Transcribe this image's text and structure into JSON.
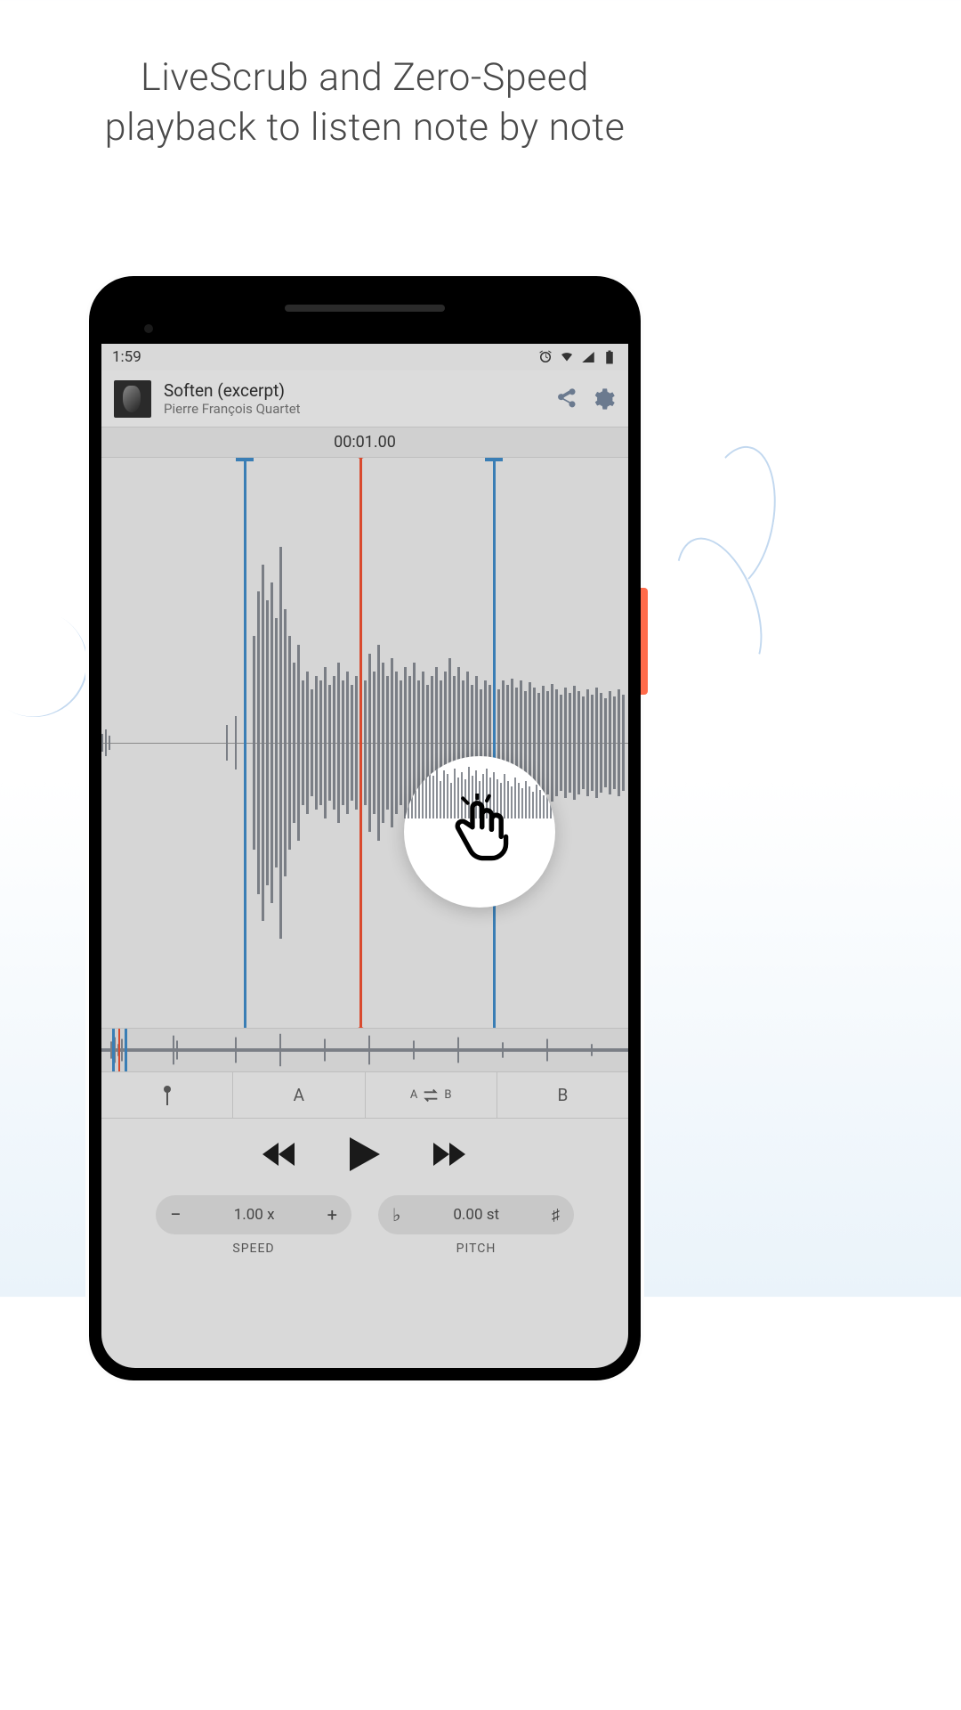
{
  "headline_line1": "LiveScrub and Zero-Speed",
  "headline_line2": "playback to listen note by note",
  "status": {
    "time": "1:59"
  },
  "header": {
    "title": "Soften (excerpt)",
    "artist": "Pierre François Quartet"
  },
  "timecode": "00:01.00",
  "markers": {
    "a": "A",
    "b": "B"
  },
  "marker_buttons": {
    "pin": "",
    "a": "A",
    "loop_a": "A",
    "loop_b": "B",
    "b": "B"
  },
  "speed": {
    "value": "1.00 x",
    "label": "SPEED",
    "minus": "−",
    "plus": "+"
  },
  "pitch": {
    "value": "0.00 st",
    "label": "PITCH",
    "flat": "♭",
    "sharp": "♯"
  }
}
